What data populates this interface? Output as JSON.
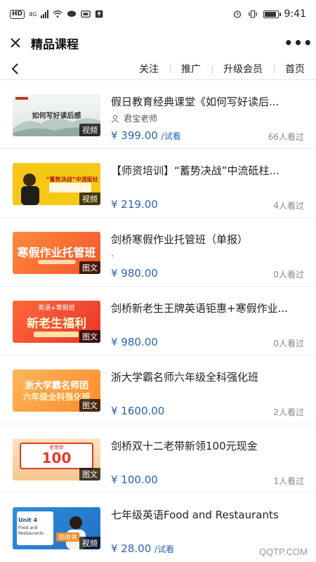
{
  "status_bar": {
    "hd": "HD",
    "net": "4G",
    "time": "9:41",
    "battery_level": 0.8
  },
  "header": {
    "title": "精品课程",
    "close_icon": "close-icon",
    "more_icon": "more-icon",
    "more_label": "•••"
  },
  "nav": {
    "back_icon": "back-icon",
    "items": [
      "关注",
      "推广",
      "升级会员",
      "首页"
    ]
  },
  "courses": [
    {
      "title": "假日教育经典课堂《如何写好读后...",
      "teacher": "君宝老师",
      "price": "¥ 399.00",
      "trial": "/试看",
      "viewers": "66人看过",
      "badge": "视频",
      "thumb_text": "如何写好读后感"
    },
    {
      "title": "【师资培训】“蓄势决战”中流砥柱...",
      "price": "¥ 219.00",
      "viewers": "4人看过",
      "badge": "视频",
      "thumb_text": "“蓄势决战”中流砥柱"
    },
    {
      "title": "剑桥寒假作业托管班（单报）",
      "dot": ".",
      "price": "¥ 980.00",
      "viewers": "0人看过",
      "badge": "图文",
      "thumb_text": "寒假作业托管班"
    },
    {
      "title": "剑桥新老生王牌英语钜惠+寒假作业...",
      "price": "¥ 980.00",
      "viewers": "0人看过",
      "badge": "图文",
      "thumb_text": "新老生福利",
      "thumb_subtext": "英语+寒假班"
    },
    {
      "title": "浙大学霸名师六年级全科强化班",
      "price": "¥ 1600.00",
      "viewers": "2人看过",
      "badge": "图文",
      "thumb_text": "浙大学霸名师团",
      "thumb_subtext": "六年级全科强化班"
    },
    {
      "title": "剑桥双十二老带新领100元现金",
      "price": "¥ 100.00",
      "viewers": "1人看过",
      "badge": "图文",
      "thumb_text": "100",
      "thumb_subtext": "老带新"
    },
    {
      "title": "七年级英语Food and Restaurants",
      "price": "¥ 28.00",
      "trial": "/试看",
      "badge": "视频",
      "thumb_text": "Unit 4",
      "thumb_subtext": "Food and Restaurants",
      "thumb_name": "郑倩男"
    }
  ],
  "watermark": "QQTP.COM",
  "colors": {
    "price": "#2a62b3",
    "viewers": "#888888",
    "badge_bg": "#000000"
  }
}
